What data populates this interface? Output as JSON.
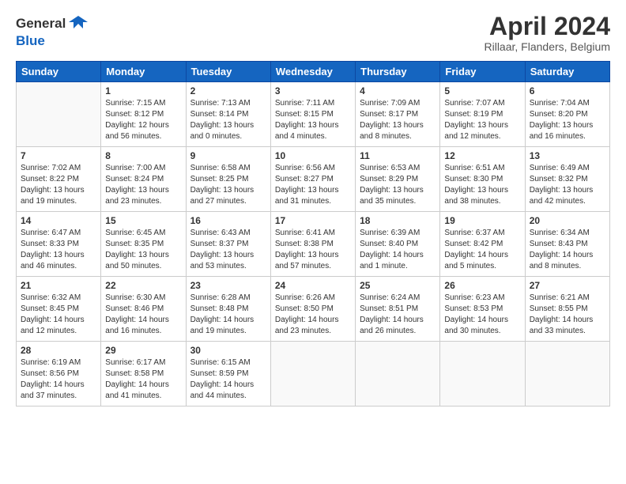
{
  "header": {
    "logo_line1": "General",
    "logo_line2": "Blue",
    "month_title": "April 2024",
    "location": "Rillaar, Flanders, Belgium"
  },
  "days_of_week": [
    "Sunday",
    "Monday",
    "Tuesday",
    "Wednesday",
    "Thursday",
    "Friday",
    "Saturday"
  ],
  "weeks": [
    [
      {
        "num": "",
        "empty": true,
        "lines": []
      },
      {
        "num": "1",
        "empty": false,
        "lines": [
          "Sunrise: 7:15 AM",
          "Sunset: 8:12 PM",
          "Daylight: 12 hours",
          "and 56 minutes."
        ]
      },
      {
        "num": "2",
        "empty": false,
        "lines": [
          "Sunrise: 7:13 AM",
          "Sunset: 8:14 PM",
          "Daylight: 13 hours",
          "and 0 minutes."
        ]
      },
      {
        "num": "3",
        "empty": false,
        "lines": [
          "Sunrise: 7:11 AM",
          "Sunset: 8:15 PM",
          "Daylight: 13 hours",
          "and 4 minutes."
        ]
      },
      {
        "num": "4",
        "empty": false,
        "lines": [
          "Sunrise: 7:09 AM",
          "Sunset: 8:17 PM",
          "Daylight: 13 hours",
          "and 8 minutes."
        ]
      },
      {
        "num": "5",
        "empty": false,
        "lines": [
          "Sunrise: 7:07 AM",
          "Sunset: 8:19 PM",
          "Daylight: 13 hours",
          "and 12 minutes."
        ]
      },
      {
        "num": "6",
        "empty": false,
        "lines": [
          "Sunrise: 7:04 AM",
          "Sunset: 8:20 PM",
          "Daylight: 13 hours",
          "and 16 minutes."
        ]
      }
    ],
    [
      {
        "num": "7",
        "empty": false,
        "lines": [
          "Sunrise: 7:02 AM",
          "Sunset: 8:22 PM",
          "Daylight: 13 hours",
          "and 19 minutes."
        ]
      },
      {
        "num": "8",
        "empty": false,
        "lines": [
          "Sunrise: 7:00 AM",
          "Sunset: 8:24 PM",
          "Daylight: 13 hours",
          "and 23 minutes."
        ]
      },
      {
        "num": "9",
        "empty": false,
        "lines": [
          "Sunrise: 6:58 AM",
          "Sunset: 8:25 PM",
          "Daylight: 13 hours",
          "and 27 minutes."
        ]
      },
      {
        "num": "10",
        "empty": false,
        "lines": [
          "Sunrise: 6:56 AM",
          "Sunset: 8:27 PM",
          "Daylight: 13 hours",
          "and 31 minutes."
        ]
      },
      {
        "num": "11",
        "empty": false,
        "lines": [
          "Sunrise: 6:53 AM",
          "Sunset: 8:29 PM",
          "Daylight: 13 hours",
          "and 35 minutes."
        ]
      },
      {
        "num": "12",
        "empty": false,
        "lines": [
          "Sunrise: 6:51 AM",
          "Sunset: 8:30 PM",
          "Daylight: 13 hours",
          "and 38 minutes."
        ]
      },
      {
        "num": "13",
        "empty": false,
        "lines": [
          "Sunrise: 6:49 AM",
          "Sunset: 8:32 PM",
          "Daylight: 13 hours",
          "and 42 minutes."
        ]
      }
    ],
    [
      {
        "num": "14",
        "empty": false,
        "lines": [
          "Sunrise: 6:47 AM",
          "Sunset: 8:33 PM",
          "Daylight: 13 hours",
          "and 46 minutes."
        ]
      },
      {
        "num": "15",
        "empty": false,
        "lines": [
          "Sunrise: 6:45 AM",
          "Sunset: 8:35 PM",
          "Daylight: 13 hours",
          "and 50 minutes."
        ]
      },
      {
        "num": "16",
        "empty": false,
        "lines": [
          "Sunrise: 6:43 AM",
          "Sunset: 8:37 PM",
          "Daylight: 13 hours",
          "and 53 minutes."
        ]
      },
      {
        "num": "17",
        "empty": false,
        "lines": [
          "Sunrise: 6:41 AM",
          "Sunset: 8:38 PM",
          "Daylight: 13 hours",
          "and 57 minutes."
        ]
      },
      {
        "num": "18",
        "empty": false,
        "lines": [
          "Sunrise: 6:39 AM",
          "Sunset: 8:40 PM",
          "Daylight: 14 hours",
          "and 1 minute."
        ]
      },
      {
        "num": "19",
        "empty": false,
        "lines": [
          "Sunrise: 6:37 AM",
          "Sunset: 8:42 PM",
          "Daylight: 14 hours",
          "and 5 minutes."
        ]
      },
      {
        "num": "20",
        "empty": false,
        "lines": [
          "Sunrise: 6:34 AM",
          "Sunset: 8:43 PM",
          "Daylight: 14 hours",
          "and 8 minutes."
        ]
      }
    ],
    [
      {
        "num": "21",
        "empty": false,
        "lines": [
          "Sunrise: 6:32 AM",
          "Sunset: 8:45 PM",
          "Daylight: 14 hours",
          "and 12 minutes."
        ]
      },
      {
        "num": "22",
        "empty": false,
        "lines": [
          "Sunrise: 6:30 AM",
          "Sunset: 8:46 PM",
          "Daylight: 14 hours",
          "and 16 minutes."
        ]
      },
      {
        "num": "23",
        "empty": false,
        "lines": [
          "Sunrise: 6:28 AM",
          "Sunset: 8:48 PM",
          "Daylight: 14 hours",
          "and 19 minutes."
        ]
      },
      {
        "num": "24",
        "empty": false,
        "lines": [
          "Sunrise: 6:26 AM",
          "Sunset: 8:50 PM",
          "Daylight: 14 hours",
          "and 23 minutes."
        ]
      },
      {
        "num": "25",
        "empty": false,
        "lines": [
          "Sunrise: 6:24 AM",
          "Sunset: 8:51 PM",
          "Daylight: 14 hours",
          "and 26 minutes."
        ]
      },
      {
        "num": "26",
        "empty": false,
        "lines": [
          "Sunrise: 6:23 AM",
          "Sunset: 8:53 PM",
          "Daylight: 14 hours",
          "and 30 minutes."
        ]
      },
      {
        "num": "27",
        "empty": false,
        "lines": [
          "Sunrise: 6:21 AM",
          "Sunset: 8:55 PM",
          "Daylight: 14 hours",
          "and 33 minutes."
        ]
      }
    ],
    [
      {
        "num": "28",
        "empty": false,
        "lines": [
          "Sunrise: 6:19 AM",
          "Sunset: 8:56 PM",
          "Daylight: 14 hours",
          "and 37 minutes."
        ]
      },
      {
        "num": "29",
        "empty": false,
        "lines": [
          "Sunrise: 6:17 AM",
          "Sunset: 8:58 PM",
          "Daylight: 14 hours",
          "and 41 minutes."
        ]
      },
      {
        "num": "30",
        "empty": false,
        "lines": [
          "Sunrise: 6:15 AM",
          "Sunset: 8:59 PM",
          "Daylight: 14 hours",
          "and 44 minutes."
        ]
      },
      {
        "num": "",
        "empty": true,
        "lines": []
      },
      {
        "num": "",
        "empty": true,
        "lines": []
      },
      {
        "num": "",
        "empty": true,
        "lines": []
      },
      {
        "num": "",
        "empty": true,
        "lines": []
      }
    ]
  ]
}
